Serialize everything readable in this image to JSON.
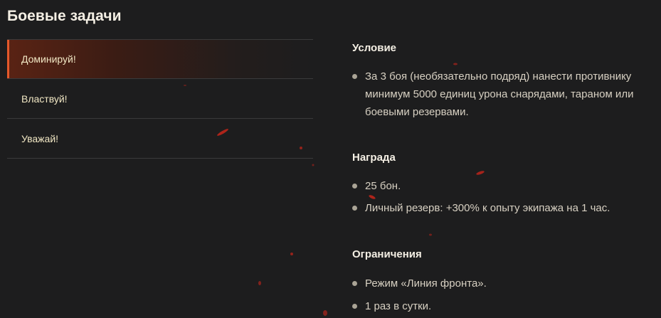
{
  "page_title": "Боевые задачи",
  "tasks": [
    {
      "label": "Доминируй!",
      "active": true
    },
    {
      "label": "Властвуй!",
      "active": false
    },
    {
      "label": "Уважай!",
      "active": false
    }
  ],
  "details": {
    "condition": {
      "title": "Условие",
      "items": [
        "За 3 боя (необязательно подряд) нанести противнику минимум 5000 единиц урона снарядами, тараном или боевыми резервами."
      ]
    },
    "reward": {
      "title": "Награда",
      "items": [
        "25 бон.",
        "Личный резерв: +300% к опыту экипажа на 1 час."
      ]
    },
    "limits": {
      "title": "Ограничения",
      "items": [
        "Режим «Линия фронта».",
        "1 раз в сутки."
      ]
    }
  },
  "colors": {
    "background": "#1d1d1e",
    "accent": "#e4582a",
    "spark": "#c8261a"
  }
}
